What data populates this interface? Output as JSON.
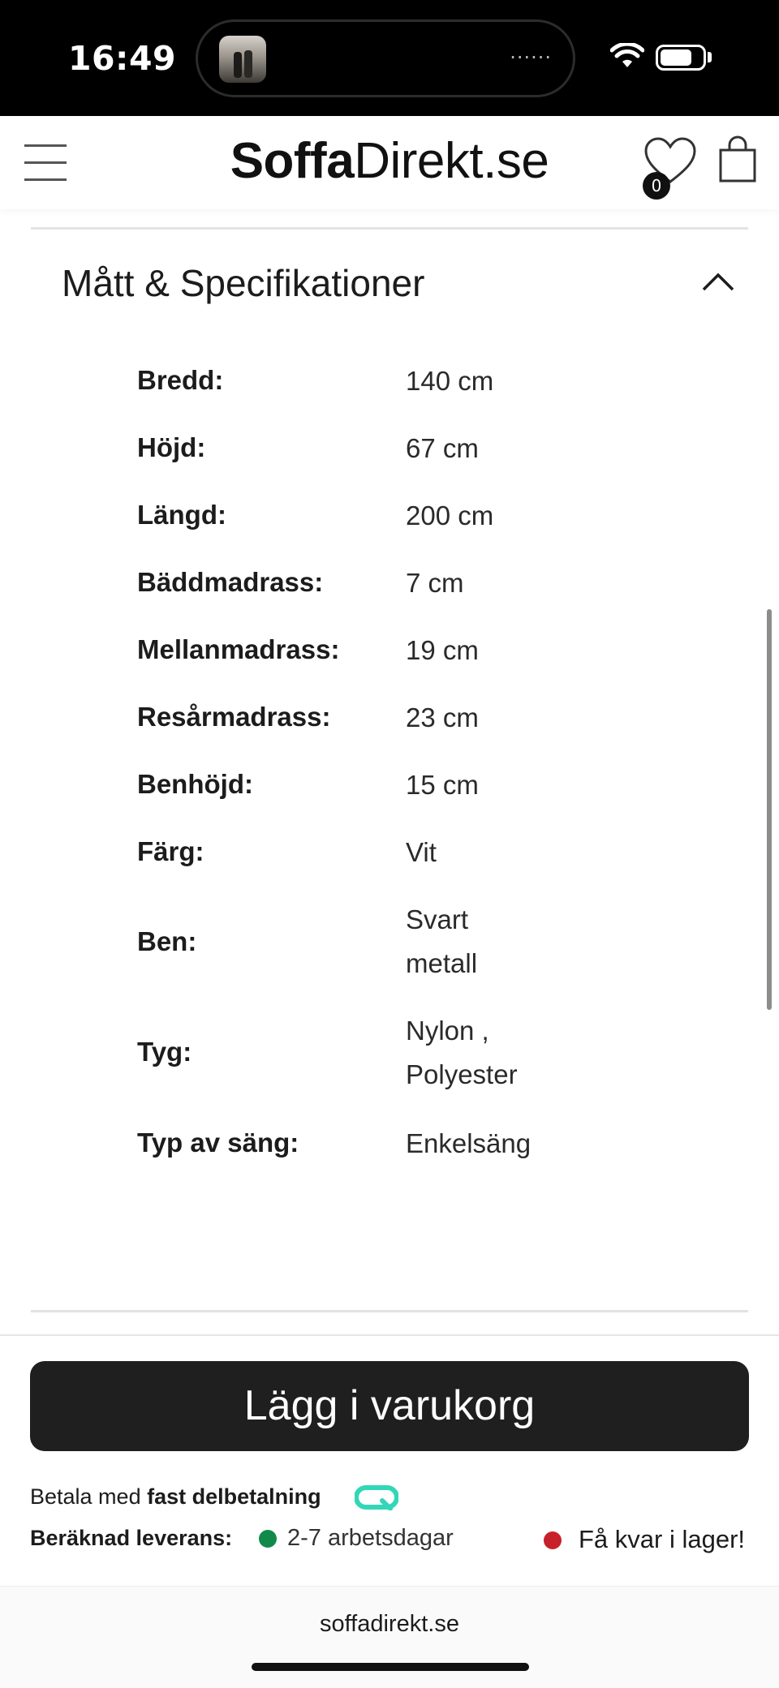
{
  "status_bar": {
    "time": "16:49",
    "island_dots": "······"
  },
  "header": {
    "logo_bold": "Soffa",
    "logo_regular": "Direkt.se",
    "wishlist_count": "0"
  },
  "section": {
    "title": "Mått & Specifikationer",
    "specs": [
      {
        "label": "Bredd:",
        "value": "140 cm"
      },
      {
        "label": "Höjd:",
        "value": "67 cm"
      },
      {
        "label": "Längd:",
        "value": "200 cm"
      },
      {
        "label": "Bäddmadrass:",
        "value": "7 cm"
      },
      {
        "label": "Mellanmadrass:",
        "value": "19 cm"
      },
      {
        "label": "Resårmadrass:",
        "value": "23 cm"
      },
      {
        "label": "Benhöjd:",
        "value": "15 cm"
      },
      {
        "label": "Färg:",
        "value": "Vit"
      },
      {
        "label": "Ben:",
        "value_line1": "Svart",
        "value_line2": "metall"
      },
      {
        "label": "Tyg:",
        "value_line1": "Nylon ,",
        "value_line2": "Polyester"
      },
      {
        "label": "Typ av säng:",
        "value": "Enkelsäng"
      }
    ]
  },
  "bottom": {
    "cart_button_label": "Lägg i varukorg",
    "pay_prefix": "Betala med ",
    "pay_bold": "fast delbetalning",
    "delivery_label": "Beräknad leverans:",
    "delivery_value": "2-7 arbetsdagar",
    "stock_value": "Få kvar i lager!"
  },
  "browser": {
    "url": "soffadirekt.se"
  },
  "colors": {
    "delivery_dot": "#0f8a4a",
    "stock_dot": "#c8202a",
    "pay_icon": "#33d6b8",
    "button_bg": "#1f1f1f"
  }
}
